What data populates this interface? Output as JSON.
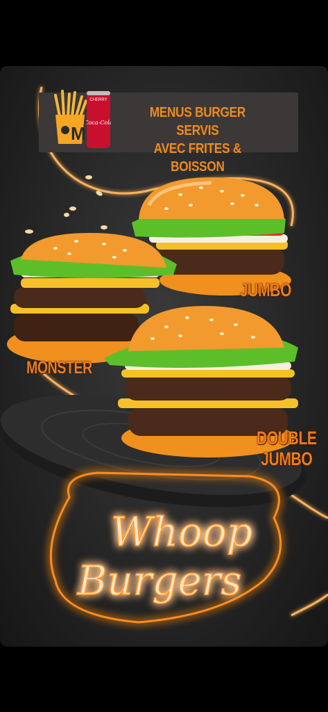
{
  "banner": {
    "line1": "MENUS BURGER SERVIS",
    "line2": "AVEC FRITES & BOISSON",
    "cola_text": "Coca-Cola",
    "cola_top": "CHERRY",
    "fries_letter": "M"
  },
  "burgers": {
    "jumbo": "JUMBO",
    "monster": "MONSTER",
    "double_jumbo_line1": "DOUBLE",
    "double_jumbo_line2": "JUMBO"
  },
  "logo": {
    "line1": "Whoop",
    "line2": "Burgers"
  },
  "colors": {
    "accent_orange": "#f08a1e",
    "neon_orange": "#ff9a2e",
    "background": "#2b2b2b"
  }
}
